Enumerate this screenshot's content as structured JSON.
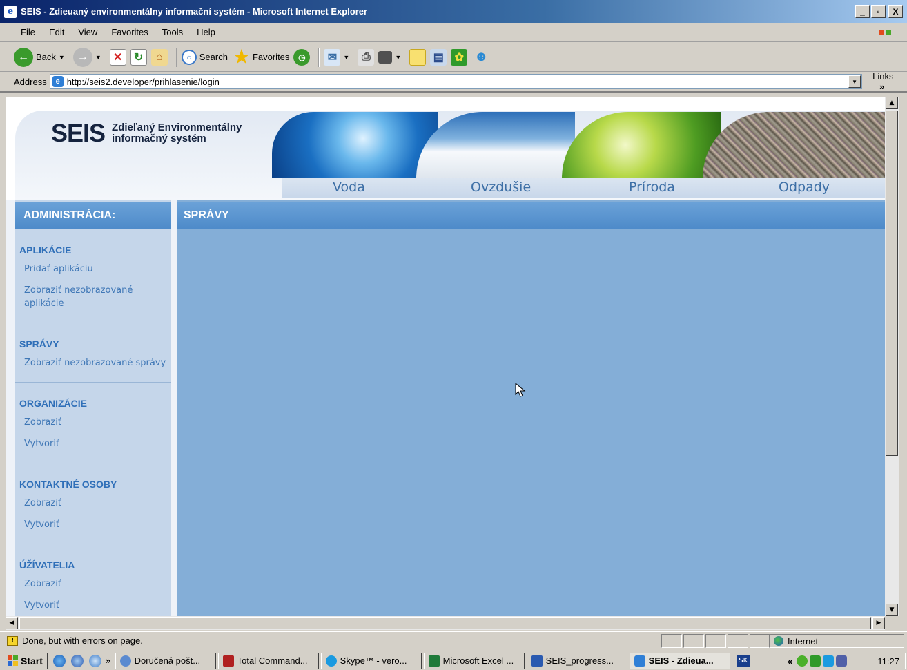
{
  "window": {
    "title": "SEIS - Zdieuaný environmentálny informační systém - Microsoft Internet Explorer",
    "icon": "ie-icon",
    "buttons": [
      "_",
      " ",
      "X"
    ]
  },
  "menu": {
    "items": [
      "File",
      "Edit",
      "View",
      "Favorites",
      "Tools",
      "Help"
    ]
  },
  "toolbar": {
    "back_label": "Back",
    "search_label": "Search",
    "favorites_label": "Favorites"
  },
  "address": {
    "label": "Address",
    "url": "http://seis2.developer/prihlasenie/login",
    "links_label": "Links",
    "links_chevron": "»"
  },
  "site": {
    "logo_main": "SEIS",
    "logo_sub_line1": "Zdieľaný Environmentálny",
    "logo_sub_line2": "informačný systém",
    "tabs": [
      "Voda",
      "Ovzdušie",
      "Príroda",
      "Odpady"
    ]
  },
  "sidebar": {
    "heading": "ADMINISTRÁCIA:",
    "sections": [
      {
        "title": "APLIKÁCIE",
        "links": [
          "Pridať aplikáciu",
          "Zobraziť nezobrazované aplikácie"
        ]
      },
      {
        "title": "SPRÁVY",
        "links": [
          "Zobraziť nezobrazované správy"
        ]
      },
      {
        "title": "ORGANIZÁCIE",
        "links": [
          "Zobraziť",
          "Vytvoriť"
        ]
      },
      {
        "title": "KONTAKTNÉ OSOBY",
        "links": [
          "Zobraziť",
          "Vytvoriť"
        ]
      },
      {
        "title": "ÚŽÍVATELIA",
        "links": [
          "Zobraziť",
          "Vytvoriť"
        ]
      }
    ]
  },
  "main": {
    "heading": "SPRÁVY"
  },
  "status": {
    "text": "Done, but with errors on page.",
    "zone": "Internet"
  },
  "taskbar": {
    "start_label": "Start",
    "more": "»",
    "tasks": [
      {
        "label": "Doručená pošt...",
        "active": false
      },
      {
        "label": "Total Command...",
        "active": false
      },
      {
        "label": "Skype™ - vero...",
        "active": false
      },
      {
        "label": "Microsoft Excel ...",
        "active": false
      },
      {
        "label": "SEIS_progress...",
        "active": false
      },
      {
        "label": "SEIS - Zdieua...",
        "active": true
      }
    ],
    "lang": "SK",
    "tray_more": "«",
    "clock": "11:27"
  },
  "colors": {
    "accent": "#4d8ac9",
    "sidebar_bg": "#c5d6ea",
    "main_bg": "#84aed7",
    "link": "#3f77b6"
  }
}
